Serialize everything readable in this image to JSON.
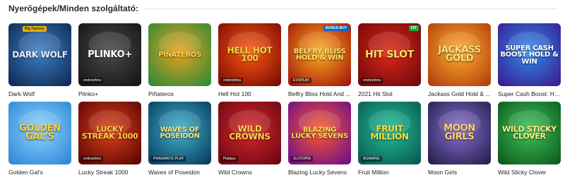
{
  "section": {
    "title": "Nyerőgépek/Minden szolgáltató:"
  },
  "games": [
    {
      "name": "Dark Wolf",
      "logo": "DARK WOLF",
      "provider": "",
      "badge": "Big Factory",
      "badge_style": "yellow",
      "bg1": "#0d2b55",
      "bg2": "#3f7fc5",
      "logo_color": "#e7efff"
    },
    {
      "name": "Plinko+",
      "logo": "PLINKO+",
      "provider": "endorphina",
      "badge": "",
      "badge_style": "",
      "bg1": "#151515",
      "bg2": "#4a4a4a",
      "logo_color": "#ffffff"
    },
    {
      "name": "Piñateros",
      "logo": "PIÑATEROS",
      "provider": "",
      "badge": "",
      "badge_style": "",
      "bg1": "#2f8a3a",
      "bg2": "#e8a21c",
      "logo_color": "#ffd44a"
    },
    {
      "name": "Hell Hot 100",
      "logo": "HELL HOT 100",
      "provider": "endorphina",
      "badge": "",
      "badge_style": "",
      "bg1": "#7a0b05",
      "bg2": "#ff5a12",
      "logo_color": "#ffd23a"
    },
    {
      "name": "Belfry Bliss Hold And ...",
      "logo": "BELFRY BLISS HOLD & WIN",
      "provider": "EVOPLAY",
      "badge": "BONUS BUY",
      "badge_style": "blue",
      "bg1": "#a3150a",
      "bg2": "#ffb020",
      "logo_color": "#ffe36b"
    },
    {
      "name": "2021 Hit Slot",
      "logo": "HIT SLOT",
      "provider": "endorphina",
      "badge": "HIT",
      "badge_style": "green",
      "bg1": "#6e0909",
      "bg2": "#e0271a",
      "logo_color": "#ffdf5a"
    },
    {
      "name": "Jackass Gold Hold & ...",
      "logo": "JACKASS GOLD",
      "provider": "",
      "badge": "",
      "badge_style": "",
      "bg1": "#b33f0d",
      "bg2": "#ffae2e",
      "logo_color": "#ffe27a"
    },
    {
      "name": "Super Cash Boost: Ho...",
      "logo": "SUPER CASH BOOST HOLD & WIN",
      "provider": "",
      "badge": "",
      "badge_style": "",
      "bg1": "#3a1c8f",
      "bg2": "#2f8ff0",
      "logo_color": "#ffffff"
    },
    {
      "name": "Golden Gal's",
      "logo": "GOLDEN GAL'S",
      "provider": "",
      "badge": "",
      "badge_style": "",
      "bg1": "#2f88d6",
      "bg2": "#8ed3ff",
      "logo_color": "#ffd23a"
    },
    {
      "name": "Lucky Streak 1000",
      "logo": "LUCKY STREAK 1000",
      "provider": "endorphina",
      "badge": "",
      "badge_style": "",
      "bg1": "#5a0504",
      "bg2": "#e0421a",
      "logo_color": "#ffcf3a"
    },
    {
      "name": "Waves of Poseidon",
      "logo": "WAVES OF POSEIDON",
      "provider": "PRAGMATIC PLAY",
      "badge": "",
      "badge_style": "",
      "bg1": "#0a3b5c",
      "bg2": "#3fb3cf",
      "logo_color": "#ffe27a"
    },
    {
      "name": "Wild Crowns",
      "logo": "WILD CROWNS",
      "provider": "Platipus",
      "badge": "",
      "badge_style": "",
      "bg1": "#6a0713",
      "bg2": "#d8282a",
      "logo_color": "#ffd34a"
    },
    {
      "name": "Blazing Lucky Sevens",
      "logo": "BLAZING LUCKY SEVENS",
      "provider": "SLOTOPIA",
      "badge": "",
      "badge_style": "",
      "bg1": "#6d0e8a",
      "bg2": "#ff5b2a",
      "logo_color": "#ffde4a"
    },
    {
      "name": "Fruit Million",
      "logo": "FRUIT MILLION",
      "provider": "BGAMING",
      "badge": "",
      "badge_style": "",
      "bg1": "#0a5a52",
      "bg2": "#1fbf9a",
      "logo_color": "#ffe03a"
    },
    {
      "name": "Moon Girls",
      "logo": "MOON GIRLS",
      "provider": "",
      "badge": "",
      "badge_style": "",
      "bg1": "#24204d",
      "bg2": "#8b6fd4",
      "logo_color": "#ffd36a"
    },
    {
      "name": "Wild Sticky Clover",
      "logo": "WILD STICKY CLOVER",
      "provider": "",
      "badge": "",
      "badge_style": "",
      "bg1": "#0d5a1f",
      "bg2": "#3ec45a",
      "logo_color": "#fff27a"
    }
  ]
}
